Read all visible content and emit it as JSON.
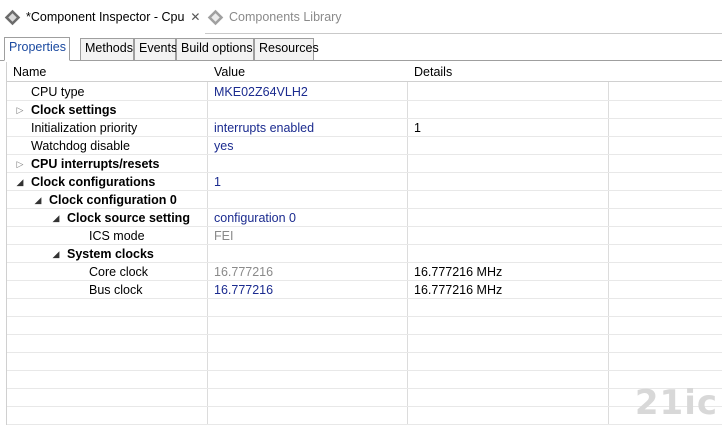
{
  "editor_tabs": {
    "active": {
      "label": "*Component Inspector - Cpu"
    },
    "inactive": {
      "label": "Components Library"
    }
  },
  "view_tabs": [
    "Properties",
    "Methods",
    "Events",
    "Build options",
    "Resources"
  ],
  "grid": {
    "headers": {
      "name": "Name",
      "value": "Value",
      "details": "Details"
    },
    "rows": [
      {
        "name": "CPU type",
        "value": "MKE02Z64VLH2",
        "details": ""
      },
      {
        "name": "Clock settings",
        "value": "",
        "details": ""
      },
      {
        "name": "Initialization priority",
        "value": "interrupts enabled",
        "details": "1"
      },
      {
        "name": "Watchdog disable",
        "value": "yes",
        "details": ""
      },
      {
        "name": "CPU interrupts/resets",
        "value": "",
        "details": ""
      },
      {
        "name": "Clock configurations",
        "value": "1",
        "details": ""
      },
      {
        "name": "Clock configuration 0",
        "value": "",
        "details": ""
      },
      {
        "name": "Clock source setting",
        "value": "configuration 0",
        "details": ""
      },
      {
        "name": "ICS mode",
        "value": "FEI",
        "details": ""
      },
      {
        "name": "System clocks",
        "value": "",
        "details": ""
      },
      {
        "name": "Core clock",
        "value": "16.777216",
        "details": "16.777216 MHz"
      },
      {
        "name": "Bus clock",
        "value": "16.777216",
        "details": "16.777216 MHz"
      }
    ]
  },
  "watermark": "21ic"
}
